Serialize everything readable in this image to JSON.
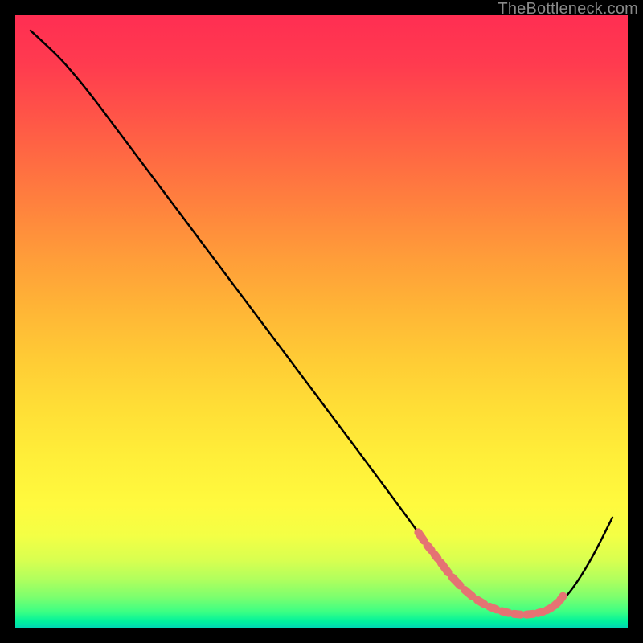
{
  "watermark": "TheBottleneck.com",
  "chart_data": {
    "type": "line",
    "title": "",
    "xlabel": "",
    "ylabel": "",
    "xlim": [
      0,
      100
    ],
    "ylim": [
      0,
      100
    ],
    "grid": false,
    "series": [
      {
        "name": "curve",
        "color": "#000000",
        "x": [
          2.5,
          5,
          8,
          12,
          18,
          24,
          30,
          36,
          42,
          48,
          54,
          59,
          63,
          66.5,
          69,
          71,
          73,
          76,
          79,
          82,
          85,
          87.5,
          89.5,
          91,
          93,
          95,
          97.5
        ],
        "y": [
          97.5,
          95.2,
          92.3,
          87.5,
          79.5,
          71.5,
          63.5,
          55.5,
          47.5,
          39.5,
          31.5,
          24.8,
          19.4,
          14.6,
          11.2,
          8.6,
          6.5,
          4.0,
          2.6,
          2.1,
          2.2,
          3.0,
          4.6,
          6.4,
          9.4,
          13.0,
          18.0
        ]
      },
      {
        "name": "highlight-dashes",
        "color": "#e57373",
        "style": "dash-segments",
        "x": [
          65.5,
          67.0,
          68.2,
          69.2,
          71.0,
          73.0,
          75.0,
          77.0,
          79.0,
          81.0,
          83.0,
          85.0,
          86.5,
          87.8,
          88.8,
          89.6
        ],
        "y": [
          16.0,
          13.8,
          12.3,
          11.0,
          8.6,
          6.5,
          4.8,
          3.6,
          2.8,
          2.3,
          2.1,
          2.3,
          2.7,
          3.4,
          4.3,
          5.4
        ]
      }
    ]
  }
}
